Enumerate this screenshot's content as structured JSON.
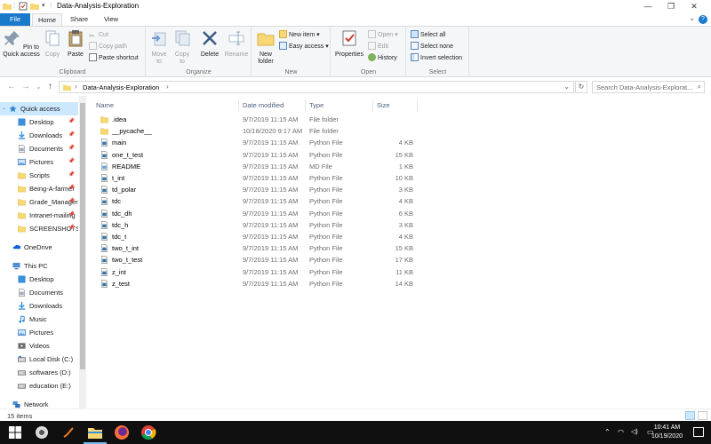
{
  "window": {
    "title": "Data-Analysis-Exploration",
    "controls": {
      "minimize": "—",
      "maximize": "❐",
      "close": "✕"
    }
  },
  "ribbon": {
    "tabs": [
      "File",
      "Home",
      "Share",
      "View"
    ],
    "help": "?",
    "collapse": "⌄",
    "clipboard": {
      "label": "Clipboard",
      "pin_to_quick_access": "Pin to Quick access",
      "copy": "Copy",
      "paste": "Paste",
      "cut": "Cut",
      "copy_path": "Copy path",
      "paste_shortcut": "Paste shortcut"
    },
    "organize": {
      "label": "Organize",
      "move_to": "Move to",
      "copy_to": "Copy to",
      "delete": "Delete",
      "rename": "Rename"
    },
    "new": {
      "label": "New",
      "new_folder": "New folder",
      "new_item": "New item ▾",
      "easy_access": "Easy access ▾"
    },
    "open": {
      "label": "Open",
      "properties": "Properties",
      "open": "Open ▾",
      "edit": "Edit",
      "history": "History"
    },
    "select": {
      "label": "Select",
      "select_all": "Select all",
      "select_none": "Select none",
      "invert_selection": "Invert selection"
    }
  },
  "address_bar": {
    "back": "←",
    "forward": "→",
    "recent": "⌄",
    "up": "↑",
    "path": "Data-Analysis-Exploration",
    "sep": "›",
    "dropdown": "⌄",
    "refresh": "↻",
    "search_placeholder": "Search Data-Analysis-Explorat..."
  },
  "navigation": {
    "quick_access": "Quick access",
    "quick_items": [
      "Desktop",
      "Downloads",
      "Documents",
      "Pictures",
      "Scripts",
      "Being-A-farmer",
      "Grade_Managem",
      "Intranet-mailing",
      "SCREENSHOTS"
    ],
    "onedrive": "OneDrive",
    "this_pc": "This PC",
    "pc_items": [
      "Desktop",
      "Documents",
      "Downloads",
      "Music",
      "Pictures",
      "Videos",
      "Local Disk (C:)",
      "softwares (D:)",
      "education (E:)"
    ],
    "network": "Network"
  },
  "columns": {
    "name": "Name",
    "date": "Date modified",
    "type": "Type",
    "size": "Size"
  },
  "files": [
    {
      "name": ".idea",
      "date": "9/7/2019 11:15 AM",
      "type": "File folder",
      "size": "",
      "icon": "folder-icon"
    },
    {
      "name": "__pycache__",
      "date": "10/18/2020 9:17 AM",
      "type": "File folder",
      "size": "",
      "icon": "folder-icon"
    },
    {
      "name": "main",
      "date": "9/7/2019 11:15 AM",
      "type": "Python File",
      "size": "4 KB",
      "icon": "python-file-icon"
    },
    {
      "name": "one_t_test",
      "date": "9/7/2019 11:15 AM",
      "type": "Python File",
      "size": "15 KB",
      "icon": "python-file-icon"
    },
    {
      "name": "README",
      "date": "9/7/2019 11:15 AM",
      "type": "MD File",
      "size": "1 KB",
      "icon": "md-file-icon"
    },
    {
      "name": "t_int",
      "date": "9/7/2019 11:15 AM",
      "type": "Python File",
      "size": "10 KB",
      "icon": "python-file-icon"
    },
    {
      "name": "td_polar",
      "date": "9/7/2019 11:15 AM",
      "type": "Python File",
      "size": "3 KB",
      "icon": "python-file-icon"
    },
    {
      "name": "tdc",
      "date": "9/7/2019 11:15 AM",
      "type": "Python File",
      "size": "4 KB",
      "icon": "python-file-icon"
    },
    {
      "name": "tdc_dh",
      "date": "9/7/2019 11:15 AM",
      "type": "Python File",
      "size": "6 KB",
      "icon": "python-file-icon"
    },
    {
      "name": "tdc_h",
      "date": "9/7/2019 11:15 AM",
      "type": "Python File",
      "size": "3 KB",
      "icon": "python-file-icon"
    },
    {
      "name": "tdc_t",
      "date": "9/7/2019 11:15 AM",
      "type": "Python File",
      "size": "4 KB",
      "icon": "python-file-icon"
    },
    {
      "name": "two_t_int",
      "date": "9/7/2019 11:15 AM",
      "type": "Python File",
      "size": "15 KB",
      "icon": "python-file-icon"
    },
    {
      "name": "two_t_test",
      "date": "9/7/2019 11:15 AM",
      "type": "Python File",
      "size": "17 KB",
      "icon": "python-file-icon"
    },
    {
      "name": "z_int",
      "date": "9/7/2019 11:15 AM",
      "type": "Python File",
      "size": "11 KB",
      "icon": "python-file-icon"
    },
    {
      "name": "z_test",
      "date": "9/7/2019 11:15 AM",
      "type": "Python File",
      "size": "14 KB",
      "icon": "python-file-icon"
    }
  ],
  "status": {
    "items_count": "15 items"
  },
  "taskbar": {
    "time": "10:41 AM",
    "date": "10/19/2020",
    "tray": {
      "chevron": "⌃",
      "wifi": "◠",
      "volume": "◁)",
      "battery": "▭"
    },
    "apps": [
      "windows-start-icon",
      "app-icon",
      "app-icon-2",
      "file-explorer-icon",
      "firefox-icon",
      "chrome-icon"
    ]
  },
  "colors": {
    "accent": "#1979ca",
    "selection": "#cce8ff",
    "folder": "#f8d775",
    "taskbar": "#101010"
  }
}
